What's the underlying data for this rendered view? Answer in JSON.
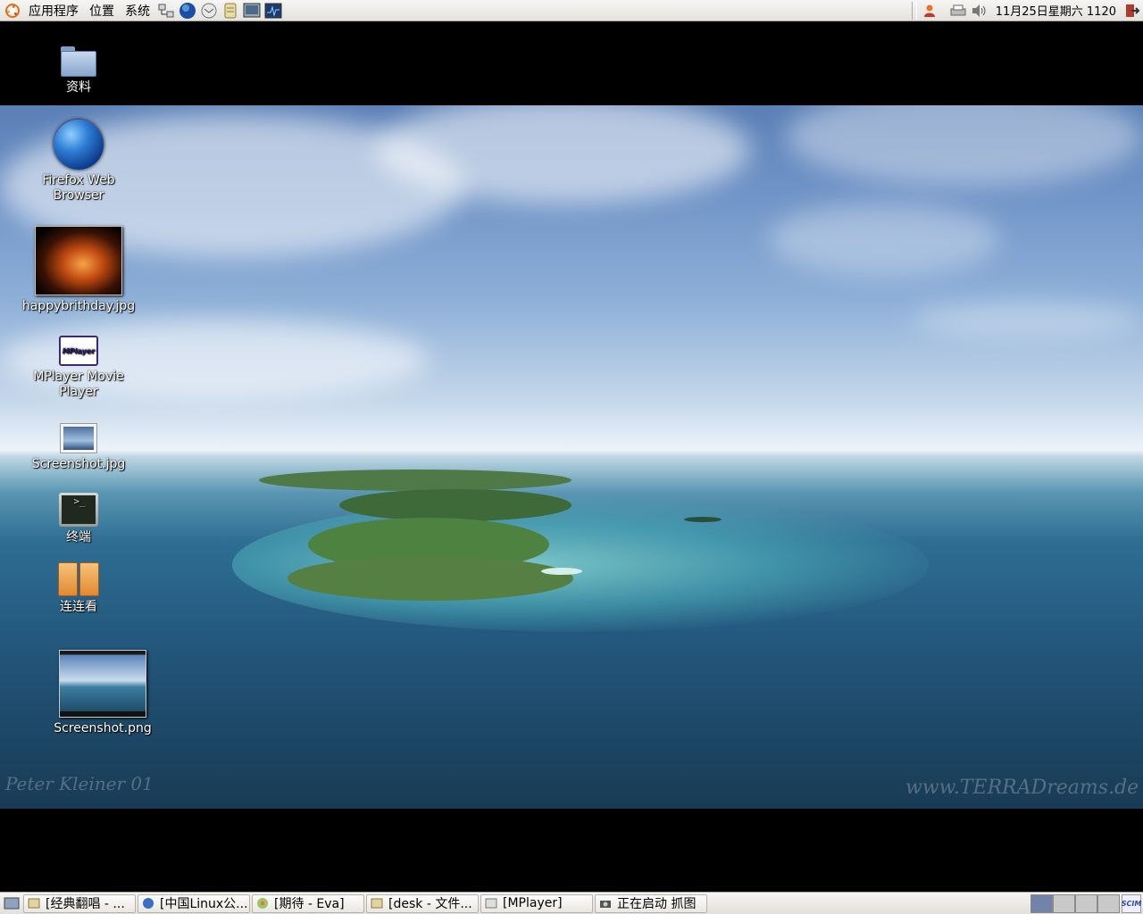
{
  "top_panel": {
    "menus": [
      "应用程序",
      "位置",
      "系统"
    ],
    "launchers": [
      "network-icon",
      "firefox-icon",
      "email-icon",
      "notes-icon",
      "screenshot-icon",
      "system-monitor-icon"
    ],
    "tray_icons": [
      "user-icon",
      "printer-icon",
      "volume-icon"
    ],
    "clock": "11月25日星期六 1120",
    "logout_icon": "logout-icon"
  },
  "desktop": {
    "icons": [
      {
        "label": "资料",
        "icon": "folder-icon"
      },
      {
        "label": "Firefox Web Browser",
        "icon": "globe-icon"
      },
      {
        "label": "happybrithday.jpg",
        "icon": "image-thumbnail"
      },
      {
        "label": "MPlayer Movie Player",
        "icon": "mplayer-icon"
      },
      {
        "label": "Screenshot.jpg",
        "icon": "image-icon"
      },
      {
        "label": "终端",
        "icon": "terminal-icon"
      },
      {
        "label": "连连看",
        "icon": "game-icon"
      },
      {
        "label": "Screenshot.png",
        "icon": "image-thumbnail"
      }
    ],
    "mplayer_logo_text": "MPlayer",
    "terminal_prompt": ">_",
    "wallpaper_credit_left": "Peter Kleiner 01",
    "wallpaper_credit_right": "www.TERRADreams.de"
  },
  "bottom_panel": {
    "tasks": [
      {
        "label": "[经典翻唱 - ...",
        "icon": "folder-icon"
      },
      {
        "label": "[中国Linux公...",
        "icon": "browser-icon"
      },
      {
        "label": "[期待 - Eva]",
        "icon": "music-icon"
      },
      {
        "label": "[desk - 文件...",
        "icon": "folder-icon"
      },
      {
        "label": "[MPlayer]",
        "icon": "mplayer-icon"
      },
      {
        "label": "正在启动 抓图",
        "icon": "camera-icon"
      }
    ],
    "scim_label": "SCIM"
  },
  "colors": {
    "panel_bg": "#efede9",
    "workspace_active": "#6f84a8"
  }
}
